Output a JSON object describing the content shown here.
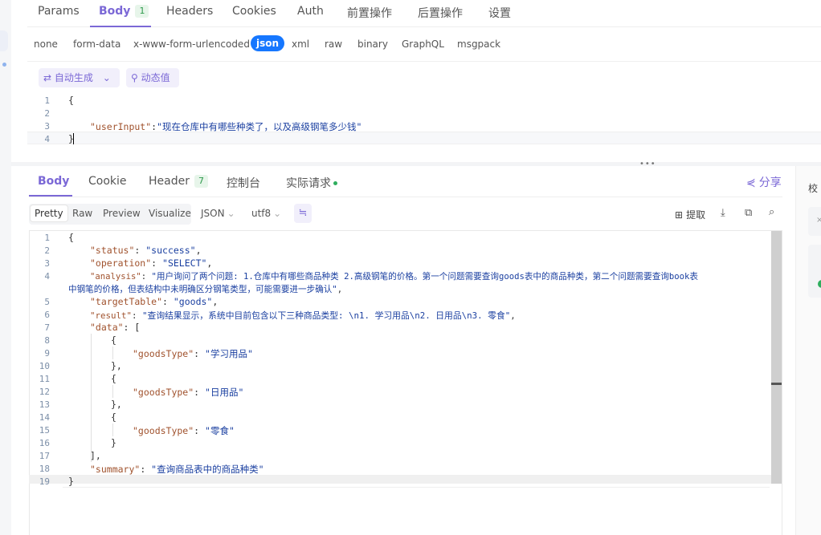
{
  "request_tabs": [
    {
      "label": "Params"
    },
    {
      "label": "Body",
      "count": "1"
    },
    {
      "label": "Headers"
    },
    {
      "label": "Cookies"
    },
    {
      "label": "Auth"
    },
    {
      "label": "前置操作"
    },
    {
      "label": "后置操作"
    },
    {
      "label": "设置"
    }
  ],
  "body_types": [
    "none",
    "form-data",
    "x-www-form-urlencoded",
    "json",
    "xml",
    "raw",
    "binary",
    "GraphQL",
    "msgpack"
  ],
  "toolbar": {
    "auto_generate": "自动生成",
    "dynamic_value": "动态值"
  },
  "request_body": {
    "line_numbers": [
      "1",
      "2",
      "3",
      "4"
    ],
    "open": "{",
    "key": "\"userInput\"",
    "value": "\"现在仓库中有哪些种类了，以及高级钢笔多少钱\"",
    "close": "}"
  },
  "response_tabs": [
    {
      "label": "Body"
    },
    {
      "label": "Cookie"
    },
    {
      "label": "Header",
      "count": "7"
    },
    {
      "label": "控制台"
    },
    {
      "label": "实际请求"
    }
  ],
  "share_label": "分享",
  "format_options": [
    "Pretty",
    "Raw",
    "Preview",
    "Visualize"
  ],
  "format_select": "JSON",
  "encoding_select": "utf8",
  "extract_label": "提取",
  "right_panel_label": "校",
  "response_body": {
    "line_numbers": [
      "1",
      "2",
      "3",
      "4",
      "5",
      "6",
      "7",
      "8",
      "9",
      "10",
      "11",
      "12",
      "13",
      "14",
      "15",
      "16",
      "17",
      "18",
      "19"
    ],
    "status": {
      "key": "\"status\"",
      "value": "\"success\""
    },
    "operation": {
      "key": "\"operation\"",
      "value": "\"SELECT\""
    },
    "analysis": {
      "key": "\"analysis\"",
      "value_line1": "\"用户询问了两个问题: 1.仓库中有哪些商品种类 2.高级钢笔的价格。第一个问题需要查询goods表中的商品种类，第二个问题需要查询book表",
      "value_line2": "中钢笔的价格，但表结构中未明确区分钢笔类型，可能需要进一步确认\""
    },
    "targetTable": {
      "key": "\"targetTable\"",
      "value": "\"goods\""
    },
    "result": {
      "key": "\"result\"",
      "value": "\"查询结果显示，系统中目前包含以下三种商品类型: \\n1. 学习用品\\n2. 日用品\\n3. 零食\""
    },
    "data_key": "\"data\"",
    "goods_key": "\"goodsType\"",
    "goods": [
      "\"学习用品\"",
      "\"日用品\"",
      "\"零食\""
    ],
    "summary": {
      "key": "\"summary\"",
      "value": "\"查询商品表中的商品种类\""
    }
  },
  "colors": {
    "accent": "#7b68d6",
    "json_active": "#1677ff",
    "key": "#a0522d",
    "string": "#1a3fa0",
    "success": "#2fae5e"
  }
}
